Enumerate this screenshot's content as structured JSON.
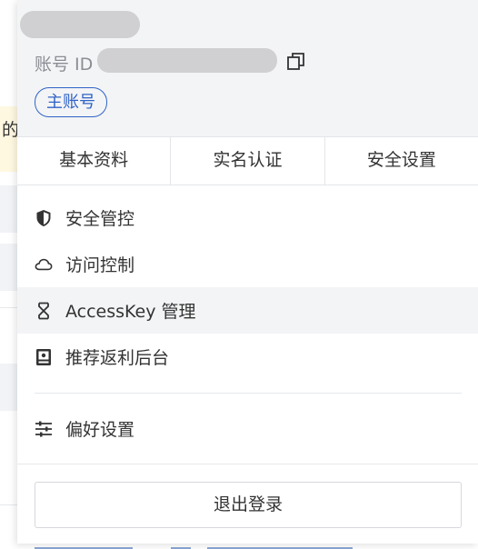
{
  "account": {
    "id_label": "账号 ID",
    "badge": "主账号"
  },
  "tabs": [
    {
      "label": "基本资料"
    },
    {
      "label": "实名认证"
    },
    {
      "label": "安全设置"
    }
  ],
  "menu": [
    {
      "label": "安全管控",
      "icon": "shield-icon"
    },
    {
      "label": "访问控制",
      "icon": "cloud-icon"
    },
    {
      "label": "AccessKey 管理",
      "icon": "key-icon",
      "highlighted": true
    },
    {
      "label": "推荐返利后台",
      "icon": "dashboard-icon"
    }
  ],
  "preferences": {
    "label": "偏好设置",
    "icon": "sliders-icon"
  },
  "logout": {
    "label": "退出登录"
  },
  "background": {
    "note_char": "的"
  },
  "colors": {
    "accent": "#2f63c6",
    "header_bg": "#f3f4f6",
    "text": "#333333"
  }
}
